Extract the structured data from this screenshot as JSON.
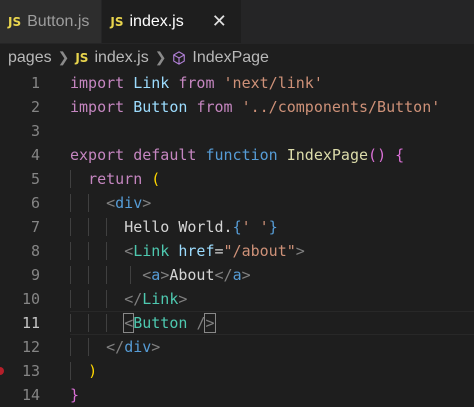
{
  "tabs": [
    {
      "badge": "JS",
      "label": "Button.js",
      "active": false
    },
    {
      "badge": "JS",
      "label": "index.js",
      "active": true,
      "close": "✕"
    }
  ],
  "breadcrumb": {
    "folder": "pages",
    "file_badge": "JS",
    "file": "index.js",
    "symbol": "IndexPage"
  },
  "line_numbers": [
    "1",
    "2",
    "3",
    "4",
    "5",
    "6",
    "7",
    "8",
    "9",
    "10",
    "11",
    "12",
    "13",
    "14"
  ],
  "code": {
    "l1": [
      "import",
      " ",
      "Link",
      " ",
      "from",
      " ",
      "'next/link'"
    ],
    "l2": [
      "import",
      " ",
      "Button",
      " ",
      "from",
      " ",
      "'../components/Button'"
    ],
    "l4": [
      "export",
      " ",
      "default",
      " ",
      "function",
      " ",
      "IndexPage",
      "(",
      ")",
      " ",
      "{"
    ],
    "l5": [
      "return",
      " ",
      "("
    ],
    "l6": [
      "<",
      "div",
      ">"
    ],
    "l7": [
      "Hello World.",
      "{",
      "' '",
      "}"
    ],
    "l8": [
      "<",
      "Link",
      " ",
      "href",
      "=",
      "\"/about\"",
      ">"
    ],
    "l9": [
      "<",
      "a",
      ">",
      "About",
      "</",
      "a",
      ">"
    ],
    "l10": [
      "</",
      "Link",
      ">"
    ],
    "l11": [
      "<",
      "Button",
      " ",
      "/",
      ">"
    ],
    "l12": [
      "</",
      "div",
      ">"
    ],
    "l13": [
      ")"
    ],
    "l14": [
      "}"
    ]
  },
  "colors": {
    "keyword": "#c586c0",
    "storage": "#569cd6",
    "function": "#dcdcaa",
    "string": "#ce9178",
    "component": "#4ec9b0",
    "js_badge": "#e8d44d",
    "breakpoint": "#b51f2a"
  },
  "icons": {
    "breadcrumb_separator": "chevron-right-icon",
    "symbol": "cube-icon",
    "close": "close-icon"
  }
}
